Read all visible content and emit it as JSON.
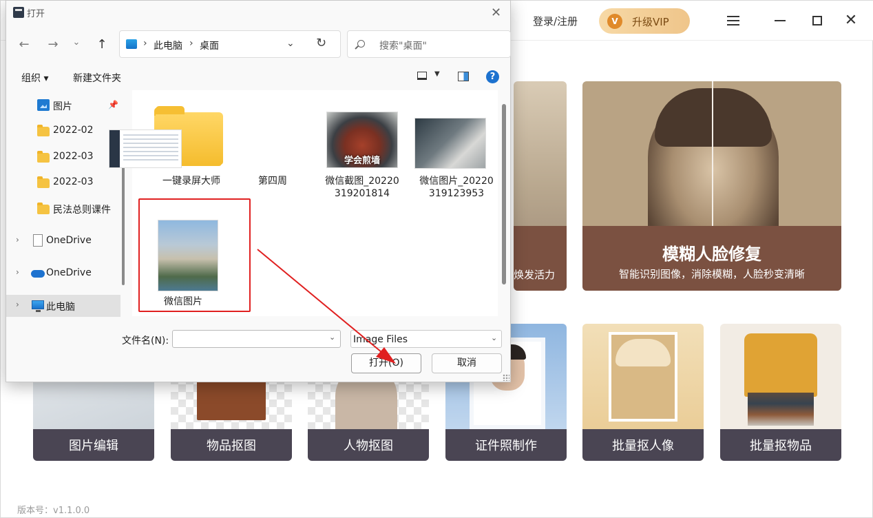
{
  "app": {
    "login_label": "登录/注册",
    "vip_badge": "V",
    "vip_label": "升级VIP",
    "cards_big": {
      "left_subtitle": "焕发活力",
      "right_title": "模糊人脸修复",
      "right_subtitle": "智能识别图像，消除模糊，人脸秒变清晰"
    },
    "cards": [
      {
        "label": "图片编辑"
      },
      {
        "label": "物品抠图"
      },
      {
        "label": "人物抠图"
      },
      {
        "label": "证件照制作"
      },
      {
        "label": "批量抠人像"
      },
      {
        "label": "批量抠物品"
      }
    ],
    "version": "版本号：v1.1.0.0"
  },
  "dialog": {
    "title": "打开",
    "close_glyph": "✕",
    "nav": {
      "back": "←",
      "forward": "→",
      "recent": "⌄",
      "up": "↑"
    },
    "address": {
      "parts": [
        "此电脑",
        "桌面"
      ],
      "separator": "›",
      "dropdown": "⌄",
      "refresh": "↻"
    },
    "search_placeholder": "搜索\"桌面\"",
    "toolbar": {
      "organize": "组织 ▾",
      "new_folder": "新建文件夹",
      "help": "?"
    },
    "nav_items": [
      {
        "label": "图片",
        "icon": "pictures-icon",
        "pinned": true
      },
      {
        "label": "2022-02",
        "icon": "folder-icon"
      },
      {
        "label": "2022-03",
        "icon": "folder-icon"
      },
      {
        "label": "2022-03",
        "icon": "folder-icon"
      },
      {
        "label": "民法总则课件",
        "icon": "folder-icon"
      },
      {
        "label": "OneDrive",
        "icon": "document-icon",
        "expand": "›"
      },
      {
        "label": "OneDrive",
        "icon": "cloud-icon",
        "expand": "›"
      },
      {
        "label": "此电脑",
        "icon": "computer-icon",
        "expand": "›",
        "selected": true
      }
    ],
    "files": [
      {
        "name": "一键录屏大师",
        "type": "folder"
      },
      {
        "name": "第四周",
        "type": "image"
      },
      {
        "name": "微信截图_20220319201814",
        "type": "image",
        "caption": "学会煎墙"
      },
      {
        "name": "微信图片_20220319123953",
        "type": "image"
      },
      {
        "name": "微信图片",
        "type": "image",
        "selected": true
      }
    ],
    "filename_label": "文件名(N):",
    "filename_value": "",
    "filetype": "Image Files",
    "open_button": "打开(O)",
    "cancel_button": "取消"
  },
  "colors": {
    "highlight_red": "#e02020",
    "card_band": "#4a4553",
    "vip_gold": "#efc58a",
    "accent_blue": "#1d72cf"
  }
}
